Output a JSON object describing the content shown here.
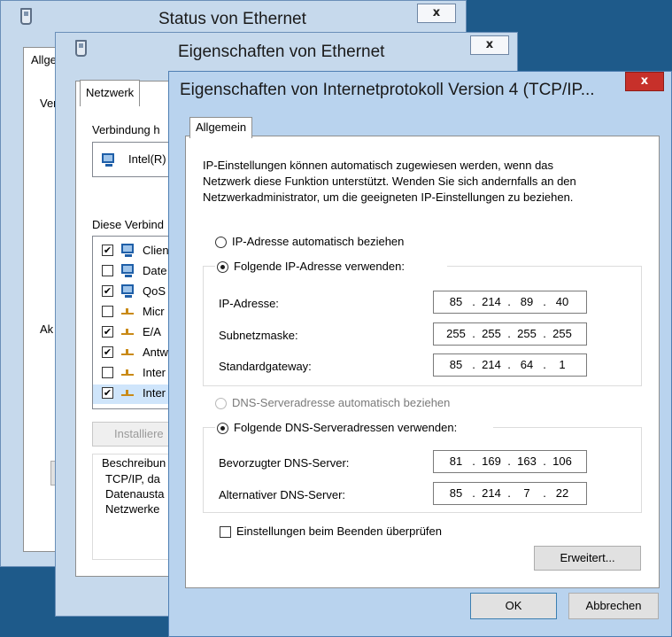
{
  "status_window": {
    "title": "Status von Ethernet",
    "close": "x",
    "tab_fragment": "Allge",
    "label_fragment_1": "Ver",
    "label_fragment_2": "Ak"
  },
  "properties_window": {
    "title": "Eigenschaften von Ethernet",
    "close": "x",
    "tab": "Netzwerk",
    "connect_using_label": "Verbindung h",
    "adapter_name": "Intel(R)",
    "components_label": "Diese Verbind",
    "components": [
      {
        "label": "Clien",
        "checked": true,
        "icon": "network-client-icon"
      },
      {
        "label": "Date",
        "checked": false,
        "icon": "computer-icon"
      },
      {
        "label": "QoS",
        "checked": true,
        "icon": "computer-icon"
      },
      {
        "label": "Micr",
        "checked": false,
        "icon": "protocol-icon"
      },
      {
        "label": "E/A",
        "checked": true,
        "icon": "protocol-icon"
      },
      {
        "label": "Antw",
        "checked": true,
        "icon": "protocol-icon"
      },
      {
        "label": "Inter",
        "checked": false,
        "icon": "protocol-icon"
      },
      {
        "label": "Inter",
        "checked": true,
        "icon": "protocol-icon"
      }
    ],
    "install_button": "Installiere",
    "description_label": "Beschreibun",
    "description_lines": [
      "TCP/IP, da",
      "Datenausta",
      "Netzwerke"
    ]
  },
  "ipv4_window": {
    "title": "Eigenschaften von Internetprotokoll Version 4 (TCP/IP...",
    "close": "x",
    "tab": "Allgemein",
    "intro": [
      "IP-Einstellungen können automatisch zugewiesen werden, wenn das",
      "Netzwerk diese Funktion unterstützt. Wenden Sie sich andernfalls an den",
      "Netzwerkadministrator, um die geeigneten IP-Einstellungen zu beziehen."
    ],
    "ip_auto_label": "IP-Adresse automatisch beziehen",
    "ip_auto_selected": false,
    "ip_manual_label": "Folgende IP-Adresse verwenden:",
    "ip_manual_selected": true,
    "ip_fields": [
      {
        "label": "IP-Adresse:",
        "octets": [
          "85",
          "214",
          "89",
          "40"
        ]
      },
      {
        "label": "Subnetzmaske:",
        "octets": [
          "255",
          "255",
          "255",
          "255"
        ]
      },
      {
        "label": "Standardgateway:",
        "octets": [
          "85",
          "214",
          "64",
          "1"
        ]
      }
    ],
    "dns_auto_label": "DNS-Serveradresse automatisch beziehen",
    "dns_auto_enabled": false,
    "dns_manual_label": "Folgende DNS-Serveradressen verwenden:",
    "dns_manual_selected": true,
    "dns_fields": [
      {
        "label": "Bevorzugter DNS-Server:",
        "octets": [
          "81",
          "169",
          "163",
          "106"
        ]
      },
      {
        "label": "Alternativer DNS-Server:",
        "octets": [
          "85",
          "214",
          "7",
          "22"
        ]
      }
    ],
    "validate_label": "Einstellungen beim Beenden überprüfen",
    "validate_checked": false,
    "advanced_button": "Erweitert...",
    "ok_button": "OK",
    "cancel_button": "Abbrechen"
  },
  "colors": {
    "desktop": "#1e5a8a",
    "window_frame": "#c6d9ec",
    "active_frame": "#b9d3ee",
    "close_red": "#c7302a"
  }
}
